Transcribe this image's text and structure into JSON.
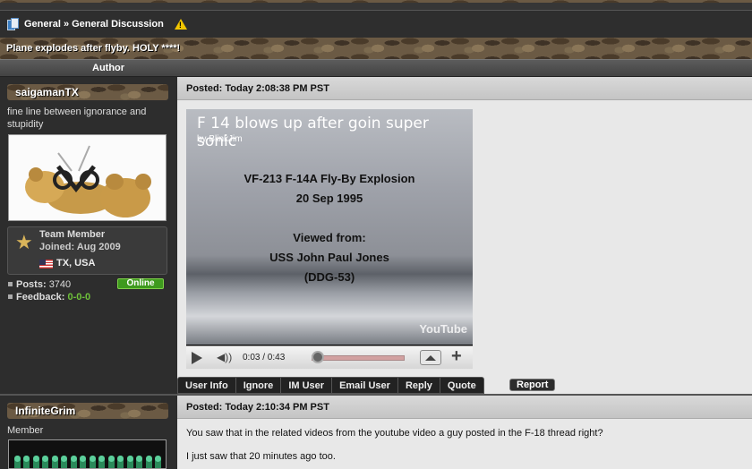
{
  "breadcrumb": {
    "section": "General",
    "separator": "»",
    "forum": "General Discussion"
  },
  "thread": {
    "title": "Plane explodes after flyby. HOLY ****!"
  },
  "columns": {
    "author": "Author"
  },
  "posts": [
    {
      "username": "saigamanTX",
      "user_title": "fine line between ignorance and stupidity",
      "rank": "Team Member",
      "joined_label": "Joined:",
      "joined": "Aug 2009",
      "location": "TX, USA",
      "posts_label": "Posts:",
      "posts": "3740",
      "feedback_label": "Feedback:",
      "feedback": "0-0-0",
      "status": "Online",
      "timestamp": "Posted: Today 2:08:38 PM PST",
      "video": {
        "title": "F 14 blows up after goin super sonic",
        "by": "by BlinkJim",
        "caption_line1": "VF-213 F-14A Fly-By Explosion",
        "caption_line2": "20 Sep 1995",
        "caption_line3": "Viewed from:",
        "caption_line4": "USS John Paul Jones",
        "caption_line5": "(DDG-53)",
        "watermark": "YouTube",
        "time": "0:03 / 0:43",
        "progress": 0.07
      }
    },
    {
      "username": "InfiniteGrim",
      "user_title": "Member",
      "timestamp": "Posted: Today 2:10:34 PM PST",
      "body_line1": "You saw that in the related videos from the youtube video a guy posted in the F-18 thread right?",
      "body_line2": "I just saw that 20 minutes ago too."
    }
  ],
  "actions": [
    "User Info",
    "Ignore",
    "IM User",
    "Email User",
    "Reply",
    "Quote"
  ],
  "report": "Report",
  "colors": {
    "online": "#3e9a1e",
    "feedback": "#6ec13a",
    "warning": "#f2c600"
  }
}
